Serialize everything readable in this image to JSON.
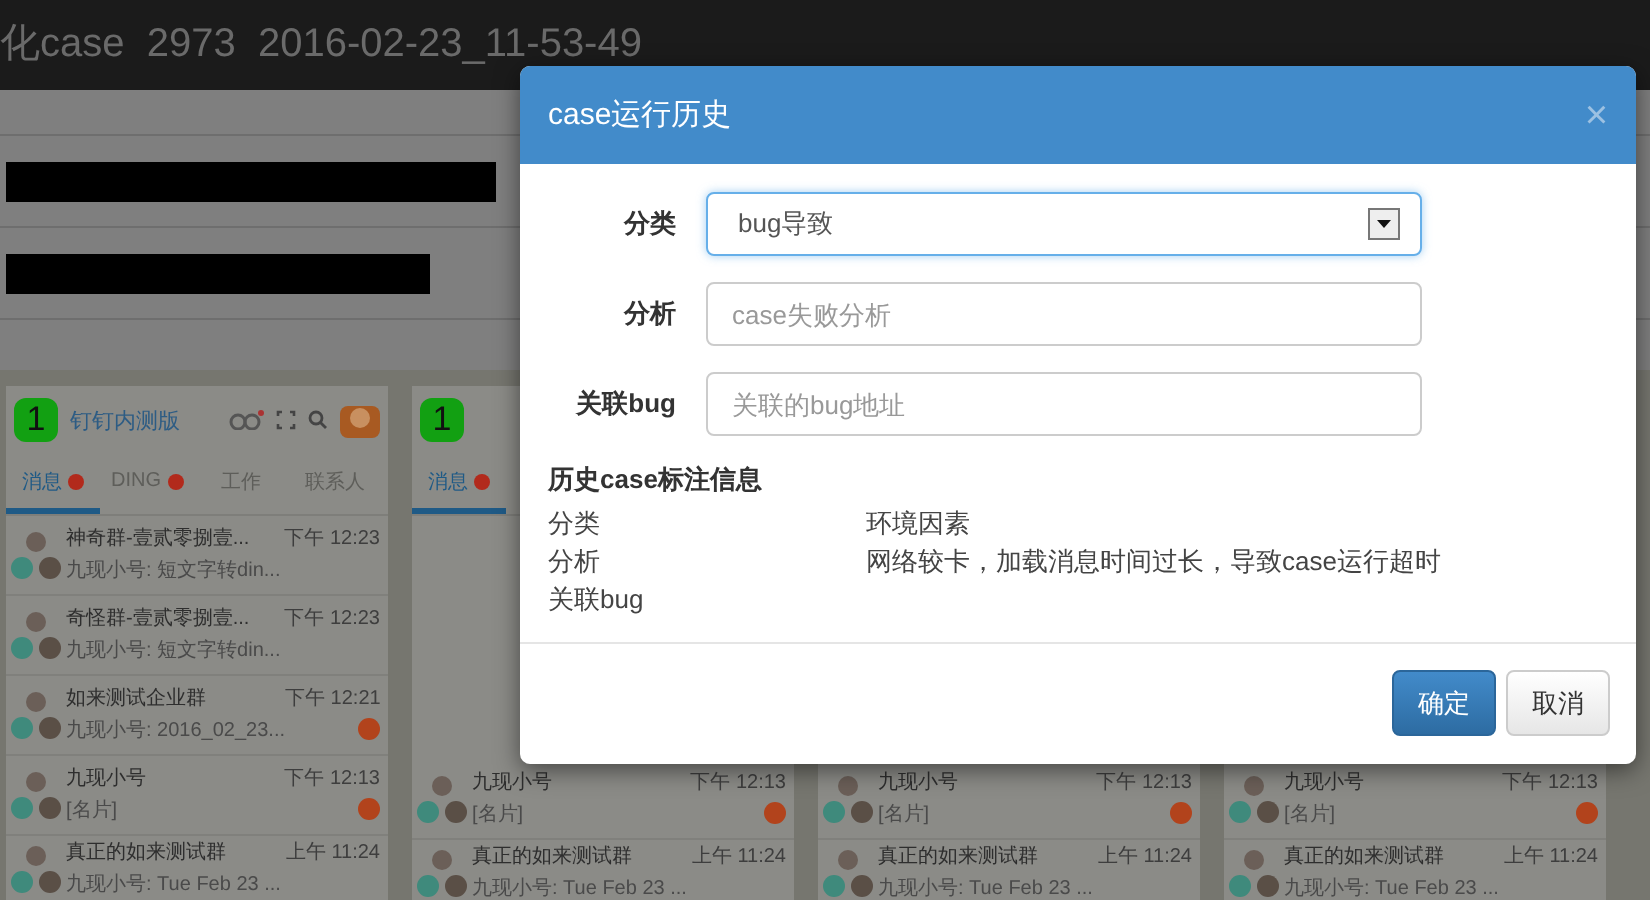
{
  "page": {
    "title": "化case  2973  2016-02-23_11-53-49"
  },
  "phones": [
    {
      "marker": "1",
      "title": "钉钉内测版",
      "tabs": [
        {
          "label": "消息",
          "badge": true,
          "selected": true
        },
        {
          "label": "DING",
          "badge": true,
          "selected": false
        },
        {
          "label": "工作",
          "badge": false,
          "selected": false
        },
        {
          "label": "联系人",
          "badge": false,
          "selected": false
        }
      ],
      "rows": [
        {
          "name": "神奇群-壹贰零捌壹...",
          "preview": "九现小号: 短文字转din...",
          "time": "下午 12:23",
          "badge": false
        },
        {
          "name": "奇怪群-壹贰零捌壹...",
          "preview": "九现小号: 短文字转din...",
          "time": "下午 12:23",
          "badge": false
        },
        {
          "name": "如来测试企业群",
          "preview": "九现小号: 2016_02_23...",
          "time": "下午 12:21",
          "badge": true
        },
        {
          "name": "九现小号",
          "preview": "[名片]",
          "time": "下午 12:13",
          "badge": true
        },
        {
          "name": "真正的如来测试群",
          "preview": "九现小号: Tue Feb 23 ...",
          "time": "上午 11:24",
          "badge": false
        }
      ]
    },
    {
      "marker": "1",
      "tabs": [
        {
          "label": "消息",
          "badge": true,
          "selected": true
        }
      ],
      "rows": [
        {
          "name": "九现小号",
          "preview": "[名片]",
          "time": "下午 12:13",
          "badge": true
        },
        {
          "name": "真正的如来测试群",
          "preview": "九现小号: Tue Feb 23 ...",
          "time": "上午 11:24",
          "badge": false
        }
      ]
    },
    {
      "rows": [
        {
          "name": "九现小号",
          "preview": "[名片]",
          "time": "下午 12:13",
          "badge": true
        },
        {
          "name": "真正的如来测试群",
          "preview": "九现小号: Tue Feb 23 ...",
          "time": "上午 11:24",
          "badge": false
        }
      ]
    },
    {
      "rows": [
        {
          "name": "九现小号",
          "preview": "[名片]",
          "time": "下午 12:13",
          "badge": true
        },
        {
          "name": "真正的如来测试群",
          "preview": "九现小号: Tue Feb 23 ...",
          "time": "上午 11:24",
          "badge": false
        }
      ]
    }
  ],
  "dialog": {
    "title": "case运行历史",
    "close": "×",
    "fields": [
      {
        "kind": "select",
        "label": "分类",
        "value": "bug导致"
      },
      {
        "kind": "input",
        "label": "分析",
        "placeholder": "case失败分析"
      },
      {
        "kind": "input",
        "label": "关联bug",
        "placeholder": "关联的bug地址"
      }
    ],
    "history": {
      "heading": "历史case标注信息",
      "rows": [
        {
          "label": "分类",
          "value": "环境因素"
        },
        {
          "label": "分析",
          "value": "网络较卡，加载消息时间过长，导致case运行超时"
        },
        {
          "label": "关联bug"
        }
      ]
    },
    "buttons": [
      {
        "label": "确定",
        "kind": "primary"
      },
      {
        "label": "取消",
        "kind": "default"
      }
    ]
  }
}
